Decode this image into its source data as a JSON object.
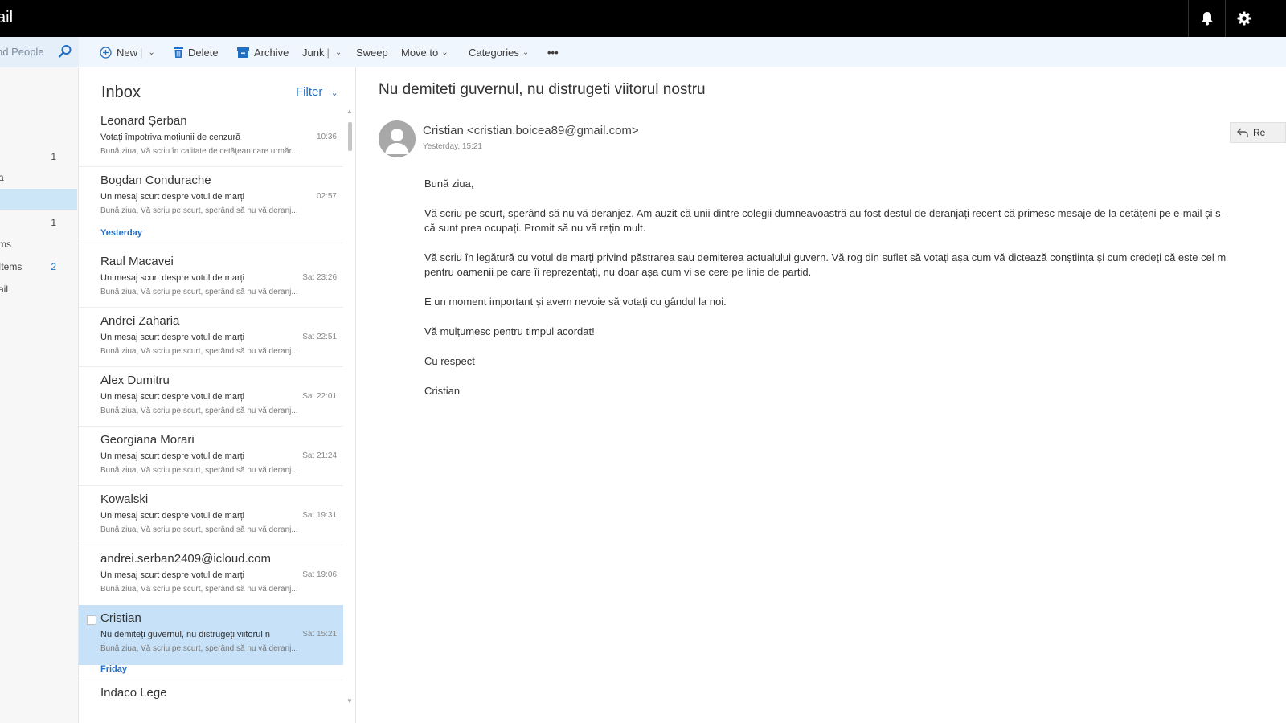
{
  "app": {
    "title": "ail"
  },
  "topbar": {
    "bell_icon": "bell-icon",
    "settings_icon": "gear-icon"
  },
  "search": {
    "placeholder": "nd People"
  },
  "toolbar": {
    "new_label": "New",
    "delete_label": "Delete",
    "archive_label": "Archive",
    "junk_label": "Junk",
    "sweep_label": "Sweep",
    "move_label": "Move to",
    "categories_label": "Categories",
    "more_label": "•••"
  },
  "folders": [
    {
      "label": "",
      "count": "1"
    },
    {
      "label": "a",
      "count": ""
    },
    {
      "label": "",
      "count": ""
    },
    {
      "label": "",
      "count": "1"
    },
    {
      "label": "ms",
      "count": ""
    },
    {
      "label": " Items",
      "count": "2"
    },
    {
      "label": "ail",
      "count": ""
    }
  ],
  "list": {
    "title": "Inbox",
    "filter_label": "Filter",
    "groups": {
      "yesterday": "Yesterday",
      "friday": "Friday"
    },
    "messages": [
      {
        "sender": "Leonard Șerban",
        "subject": "Votați împotriva moțiunii de cenzură",
        "time": "10:36",
        "preview": "Bună ziua, Vă scriu în calitate de cetățean care urmăr..."
      },
      {
        "sender": "Bogdan Condurache",
        "subject": "Un mesaj scurt despre votul de marți",
        "time": "02:57",
        "preview": "Bună ziua, Vă scriu pe scurt, sperând să nu vă deranj..."
      },
      {
        "sender": "Raul Macavei",
        "subject": "Un mesaj scurt despre votul de marți",
        "time": "Sat 23:26",
        "preview": "Bună ziua, Vă scriu pe scurt, sperând să nu vă deranj..."
      },
      {
        "sender": "Andrei Zaharia",
        "subject": "Un mesaj scurt despre votul de marți",
        "time": "Sat 22:51",
        "preview": "Bună ziua, Vă scriu pe scurt, sperând să nu vă deranj..."
      },
      {
        "sender": "Alex Dumitru",
        "subject": "Un mesaj scurt despre votul de marți",
        "time": "Sat 22:01",
        "preview": "Bună ziua, Vă scriu pe scurt, sperând să nu vă deranj..."
      },
      {
        "sender": "Georgiana Morari",
        "subject": "Un mesaj scurt despre votul de marți",
        "time": "Sat 21:24",
        "preview": "Bună ziua, Vă scriu pe scurt, sperând să nu vă deranj..."
      },
      {
        "sender": "Kowalski",
        "subject": "Un mesaj scurt despre votul de marți",
        "time": "Sat 19:31",
        "preview": "Bună ziua, Vă scriu pe scurt, sperând să nu vă deranj..."
      },
      {
        "sender": "andrei.serban2409@icloud.com",
        "subject": "Un mesaj scurt despre votul de marți",
        "time": "Sat 19:06",
        "preview": "Bună ziua, Vă scriu pe scurt, sperând să nu vă deranj..."
      },
      {
        "sender": "Cristian",
        "subject": "Nu demiteți guvernul, nu distrugeți viitorul n",
        "time": "Sat 15:21",
        "preview": "Bună ziua, Vă scriu pe scurt, sperând să nu vă deranj..."
      },
      {
        "sender": "Indaco Lege",
        "subject": "",
        "time": "",
        "preview": ""
      }
    ]
  },
  "reading": {
    "subject": "Nu demiteti guvernul, nu distrugeti viitorul nostru",
    "from": "Cristian <cristian.boicea89@gmail.com>",
    "date": "Yesterday, 15:21",
    "reply_label": "Re",
    "body": [
      "Bună ziua,",
      "Vă scriu pe scurt, sperând să nu vă deranjez. Am auzit că unii dintre colegii dumneavoastră au fost destul de deranjați recent că primesc mesaje de la cetățeni pe e-mail și s-\ncă sunt prea ocupați. Promit să nu vă rețin mult.",
      "Vă scriu în legătură cu votul de marți privind păstrarea sau demiterea actualului guvern. Vă rog din suflet să votați așa cum vă dictează conștiința și cum credeți că este cel m\npentru oamenii pe care îi reprezentați, nu doar așa cum vi se cere pe linie de partid.",
      "E un moment important și avem nevoie să votați cu gândul la noi.",
      "Vă mulțumesc pentru timpul acordat!",
      "Cu respect",
      "Cristian"
    ]
  },
  "colors": {
    "accent": "#1f6fc5",
    "selected": "#c6e1f8",
    "topbar": "#000000",
    "toolbar": "#f0f6fd"
  }
}
